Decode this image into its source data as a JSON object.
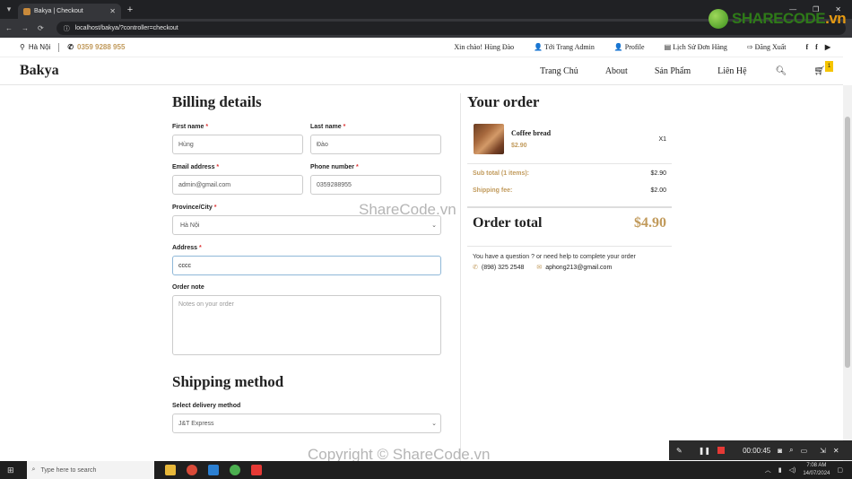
{
  "browser": {
    "tab_title": "Bakya | Checkout",
    "url": "localhost/bakya/?controller=checkout"
  },
  "topbar": {
    "location": "Hà Nội",
    "phone": "0359 9288 955",
    "greeting": "Xin chào! Hùng Đào",
    "admin": "Tới Trang Admin",
    "profile": "Profile",
    "orders": "Lịch Sử Đơn Hàng",
    "logout": "Đăng Xuất",
    "social": [
      "f",
      "f",
      "▶"
    ]
  },
  "nav": {
    "logo": "Bakya",
    "items": [
      "Trang Chủ",
      "About",
      "Sản Phẩm",
      "Liên Hệ"
    ],
    "cart_count": "1"
  },
  "billing": {
    "title": "Billing details",
    "first_name_label": "First name",
    "first_name": "Hùng",
    "last_name_label": "Last name",
    "last_name": "Đào",
    "email_label": "Email address",
    "email": "admin@gmail.com",
    "phone_label": "Phone number",
    "phone": "0359288955",
    "province_label": "Province/City",
    "province": "Hà Nội",
    "address_label": "Address",
    "address": "cccc",
    "note_label": "Order note",
    "note_placeholder": "Notes on your order"
  },
  "shipping": {
    "title": "Shipping method",
    "select_label": "Select delivery method",
    "method": "J&T Express"
  },
  "order": {
    "title": "Your order",
    "item_name": "Coffee bread",
    "item_price": "$2.90",
    "item_qty": "X1",
    "subtotal_label": "Sub total (1 items):",
    "subtotal": "$2.90",
    "shipping_label": "Shipping fee:",
    "shipping": "$2.00",
    "total_label": "Order total",
    "total": "$4.90",
    "help": "You have a question ? or need help to complete your order",
    "help_phone": "(898) 325 2548",
    "help_email": "aphong213@gmail.com"
  },
  "watermarks": {
    "center": "ShareCode.vn",
    "bottom": "Copyright © ShareCode.vn",
    "logo_main": "SHARECODE",
    "logo_suffix": ".vn"
  },
  "recorder": {
    "time": "00:00:45"
  },
  "taskbar": {
    "search": "Type here to search",
    "time": "7:08 AM",
    "date": "14/07/2024"
  }
}
